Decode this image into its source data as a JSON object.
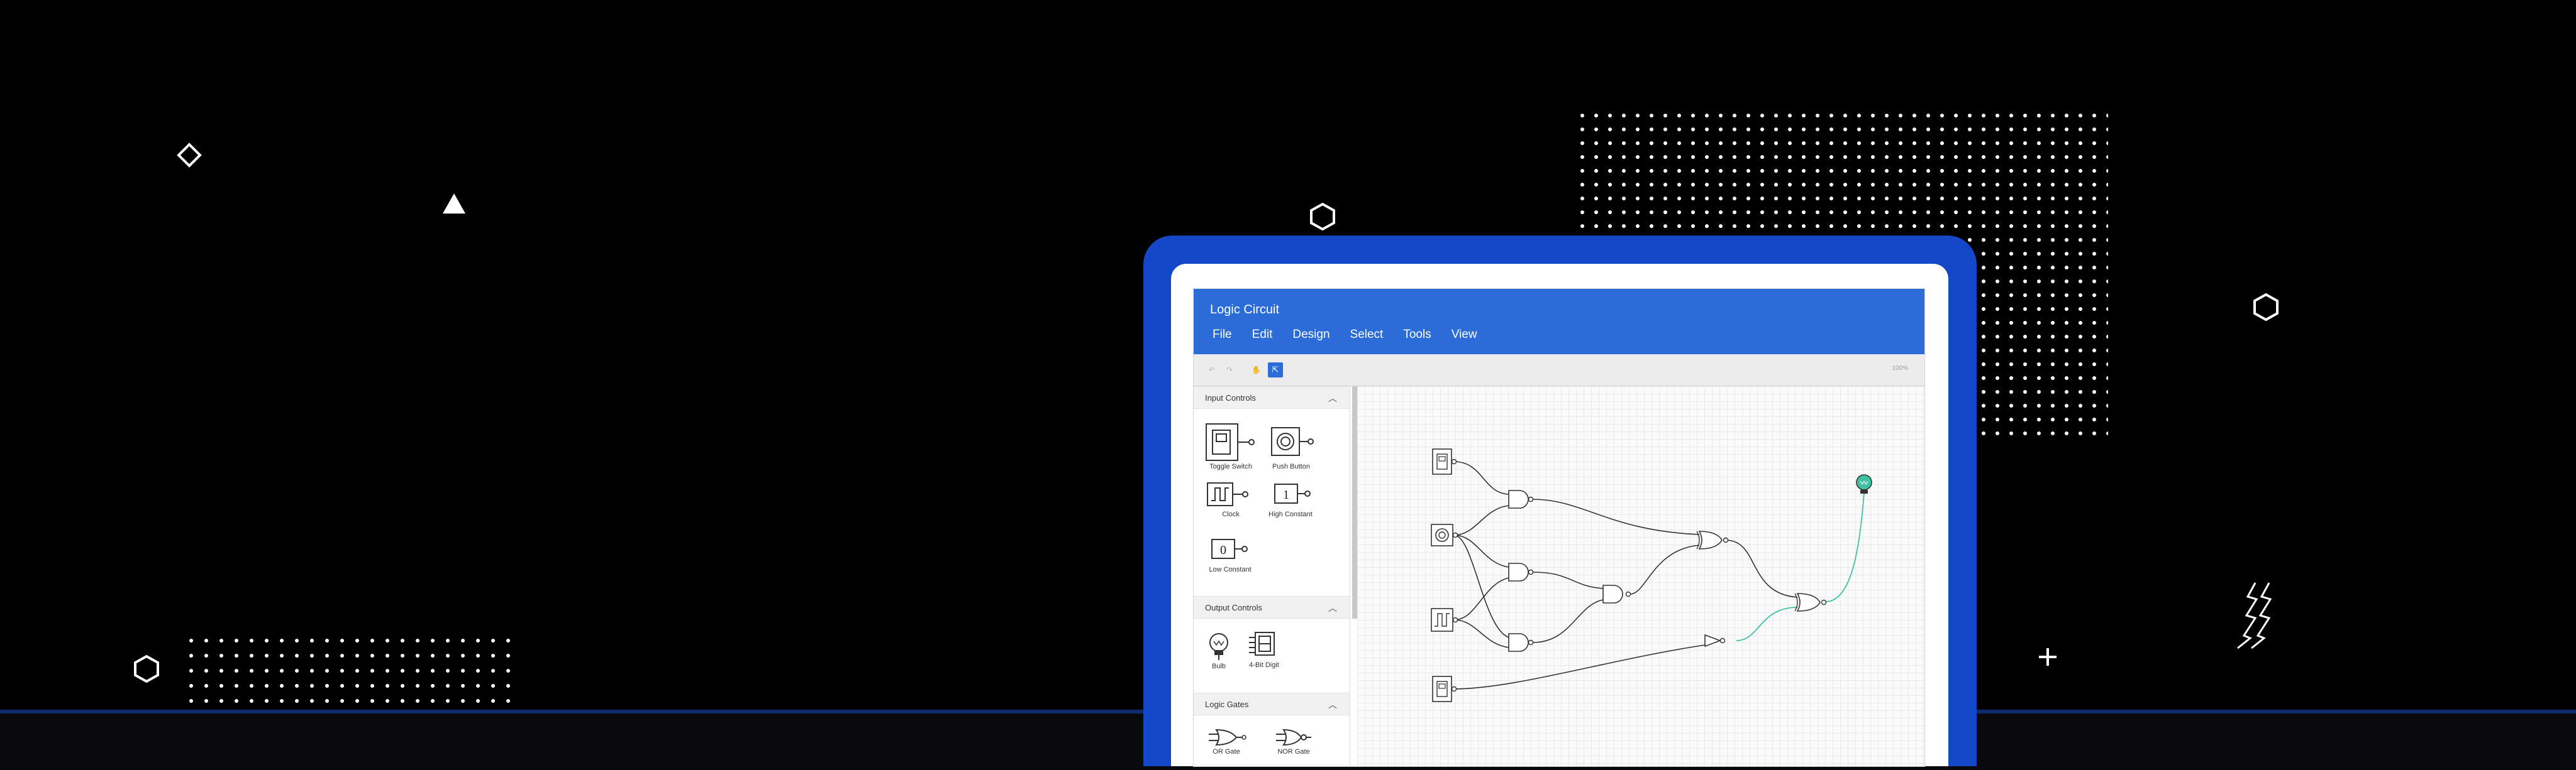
{
  "app": {
    "title": "Logic Circuit",
    "menu": [
      "File",
      "Edit",
      "Design",
      "Select",
      "Tools",
      "View"
    ],
    "zoom_label": "100%"
  },
  "toolbar": {
    "icons": [
      "undo-icon",
      "redo-icon",
      "pan-icon",
      "pointer-icon"
    ]
  },
  "palette": {
    "sections": [
      {
        "title": "Input Controls",
        "items": [
          "Toggle Switch",
          "Push Button",
          "Clock",
          "High Constant",
          "Low Constant"
        ]
      },
      {
        "title": "Output Controls",
        "items": [
          "Bulb",
          "4-Bit Digit"
        ]
      },
      {
        "title": "Logic Gates",
        "items": [
          "OR Gate",
          "NOR Gate"
        ]
      }
    ]
  },
  "colors": {
    "brand_blue": "#2b6cd8",
    "laptop_blue": "#1548c9",
    "active_wire": "#3fc2a3"
  }
}
